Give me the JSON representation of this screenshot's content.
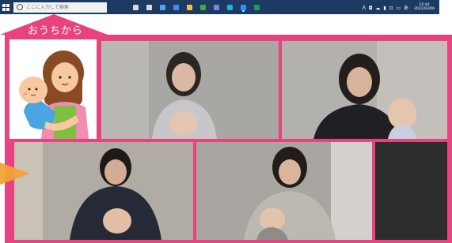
{
  "taskbar": {
    "search_placeholder": "ここに入力して検索",
    "tray_icons": "ᐱ ◘ ☁ ▮ ⊡ ▭ あ",
    "time": "15:40",
    "date": "2021/03/06",
    "apps": [
      {
        "name": "windows-circle-icon",
        "color": "#d9d9d9"
      },
      {
        "name": "task-view-icon",
        "color": "#d9d9d9"
      },
      {
        "name": "store-icon",
        "color": "#4aa4ff"
      },
      {
        "name": "mail-icon",
        "color": "#3f8cff"
      },
      {
        "name": "explorer-icon",
        "color": "#f5c542"
      },
      {
        "name": "chrome-icon",
        "color": "#3ea84a"
      },
      {
        "name": "teams-icon",
        "color": "#7b83eb"
      },
      {
        "name": "edge-icon",
        "color": "#1fb4d8"
      },
      {
        "name": "zoom-icon",
        "color": "#2d8cff"
      },
      {
        "name": "excel-icon",
        "color": "#1f9e55"
      }
    ]
  },
  "banner": {
    "label": "おうちから"
  },
  "colors": {
    "frame": "#e8437f",
    "arrow": "#f3a33a",
    "taskbar": "#1d3a63"
  },
  "tiles": [
    {
      "name": "participant-1",
      "label": ""
    },
    {
      "name": "participant-2",
      "label": ""
    },
    {
      "name": "participant-3",
      "label": ""
    },
    {
      "name": "participant-4",
      "label": ""
    }
  ]
}
